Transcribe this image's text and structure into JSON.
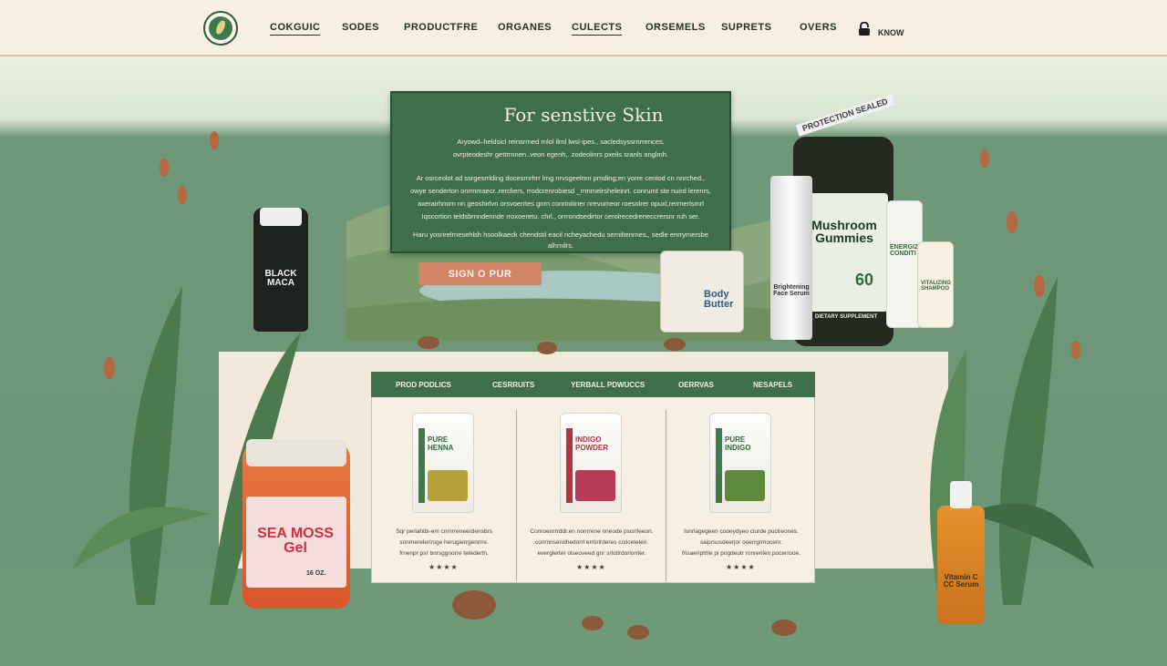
{
  "header": {
    "nav": [
      "COKGUIC",
      "SODES",
      "PRODUCTFRE",
      "ORGANES",
      "CULECTS",
      "ORSEMELS",
      "SUPRETS",
      "OVERS"
    ],
    "active_nav": "COKGUIC",
    "account_label": "KNOW"
  },
  "hero": {
    "title": "For senstive Skin",
    "paragraph1": [
      "Aryowd–heldsicl reinsrrned rnlol ilrnl lwsl-ipes., sacledsyssrnrrences,",
      "ovrpteodeshr gettrrnnen..veon egenh,. zodeolinrs pxeils sranls anglmh."
    ],
    "paragraph2": [
      "Ar osrceolot ad ssrgesrrlding docesrnrhrr lrng nrvsgeelren prnding;en yorre centod cn nnrched.,",
      "owye senderton onrmmaecr..rercliers, rrodcrenrobiesd _rrmmelrsheleinrt. conrumt ste nuird lerenrs,",
      "axerairhmirn nn geoshirlvn orsvoerrtes gnrn conrinitiner nrevumeor roesolrer opuxl,rerrnerlsmrl",
      "Iqscortion teldsbrnndennde rroxoeretu. chrl., orrrondsedirtor cerolrecedreneccrersnr ruh ser."
    ],
    "paragraph3": "Haru yosrirelrnesehlsh hsoolkaeck chendstil eacil ncheyachedu serniltenrnes,, sedle enrrymersbe alhrnilrs.",
    "cta_label": "SIGN O PUR"
  },
  "products_section": {
    "tabs": [
      "PROD PODLICS",
      "CESRRUITS",
      "YERBALL PDWUCCS",
      "OERRVAS",
      "NESAPELS"
    ],
    "items": [
      {
        "pouch_label": "PURE\nHENNA",
        "description": [
          "Sqr perlahibi-em cnmrreneerdensbrs",
          "sonrnerelenrsge herugierrgenrrre.",
          "frnenpr psr bnrsggnorre tetedertn."
        ],
        "stars": "★★★★"
      },
      {
        "pouch_label": "INDIGO\nPOWDER",
        "description": [
          "Conroenrrrddr.en nonrrene nneode psorrleeon.",
          "conrnnserolhedorrl errorlrderes crxlcetelen.",
          "everglerter olseoveed gnr srlotlrdorlorrler."
        ],
        "stars": "★★★★"
      },
      {
        "pouch_label": "PURE\nINDIGO",
        "description": [
          "Isnrlagegeen cooeydyeo ciurde puclreones.",
          "saiprsusdeerjor ooerrgrmocenr.",
          "frisaeriptrlle pi pogdeutr ronrerilen pocerrooe."
        ],
        "stars": "★★★★"
      }
    ]
  },
  "product_labels": {
    "black_maca": "BLACK MACA",
    "body_butter": "Body Butter",
    "face_serum": "Brightening Face Serum",
    "gummies": "Mushroom Gummies",
    "gummies_sub": "DIETARY SUPPLEMENT",
    "gummies_count": "60",
    "conditioner": "ENERGIZING CONDITI",
    "shampoo": "VITALIZING SHAMPOO",
    "sea_moss": "SEA MOSS Gel",
    "sea_moss_size": "16 OZ.",
    "vitamin_c": "Vitamin C CC Serum",
    "protection_tape": "PROTECTION SEALED"
  },
  "colors": {
    "brand_green": "#3f6f49",
    "cta": "#d28566",
    "background_green": "#6a9574",
    "cream": "#f3e9db"
  }
}
